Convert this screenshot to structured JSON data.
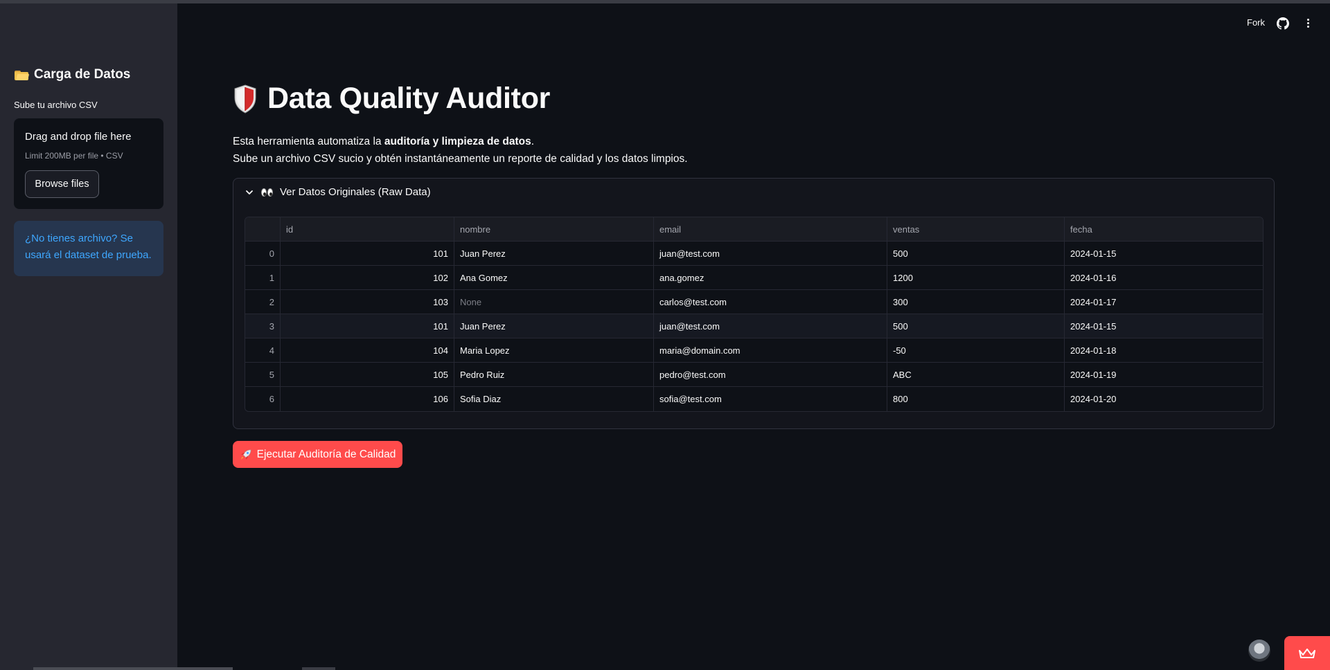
{
  "header": {
    "fork_label": "Fork"
  },
  "sidebar": {
    "title": "Carga de Datos",
    "upload_label": "Sube tu archivo CSV",
    "dropzone_title": "Drag and drop file here",
    "dropzone_limit": "Limit 200MB per file • CSV",
    "browse_label": "Browse files",
    "info_text": "¿No tienes archivo? Se usará el dataset de prueba."
  },
  "main": {
    "title": "Data Quality Auditor",
    "desc_prefix": "Esta herramienta automatiza la ",
    "desc_bold": "auditoría y limpieza de datos",
    "desc_suffix": ".",
    "desc_line2": "Sube un archivo CSV sucio y obtén instantáneamente un reporte de calidad y los datos limpios.",
    "expander_label": "Ver Datos Originales (Raw Data)",
    "run_button": "Ejecutar Auditoría de Calidad"
  },
  "table": {
    "columns": [
      "",
      "id",
      "nombre",
      "email",
      "ventas",
      "fecha"
    ],
    "rows": [
      [
        "0",
        "101",
        "Juan Perez",
        "juan@test.com",
        "500",
        "2024-01-15"
      ],
      [
        "1",
        "102",
        "Ana Gomez",
        "ana.gomez",
        "1200",
        "2024-01-16"
      ],
      [
        "2",
        "103",
        "None",
        "carlos@test.com",
        "300",
        "2024-01-17"
      ],
      [
        "3",
        "101",
        "Juan Perez",
        "juan@test.com",
        "500",
        "2024-01-15"
      ],
      [
        "4",
        "104",
        "Maria Lopez",
        "maria@domain.com",
        "-50",
        "2024-01-18"
      ],
      [
        "5",
        "105",
        "Pedro Ruiz",
        "pedro@test.com",
        "ABC",
        "2024-01-19"
      ],
      [
        "6",
        "106",
        "Sofia Diaz",
        "sofia@test.com",
        "800",
        "2024-01-20"
      ]
    ]
  },
  "colors": {
    "background": "#0e1117",
    "sidebar": "#262730",
    "accent": "#ff4b4b",
    "info_text": "#3ea7ff",
    "info_bg": "#26364f"
  },
  "icons": [
    "folder-icon",
    "github-icon",
    "kebab-menu-icon",
    "shield-icon",
    "chevron-down-icon",
    "eyes-icon",
    "rocket-icon",
    "crown-icon",
    "avatar"
  ]
}
